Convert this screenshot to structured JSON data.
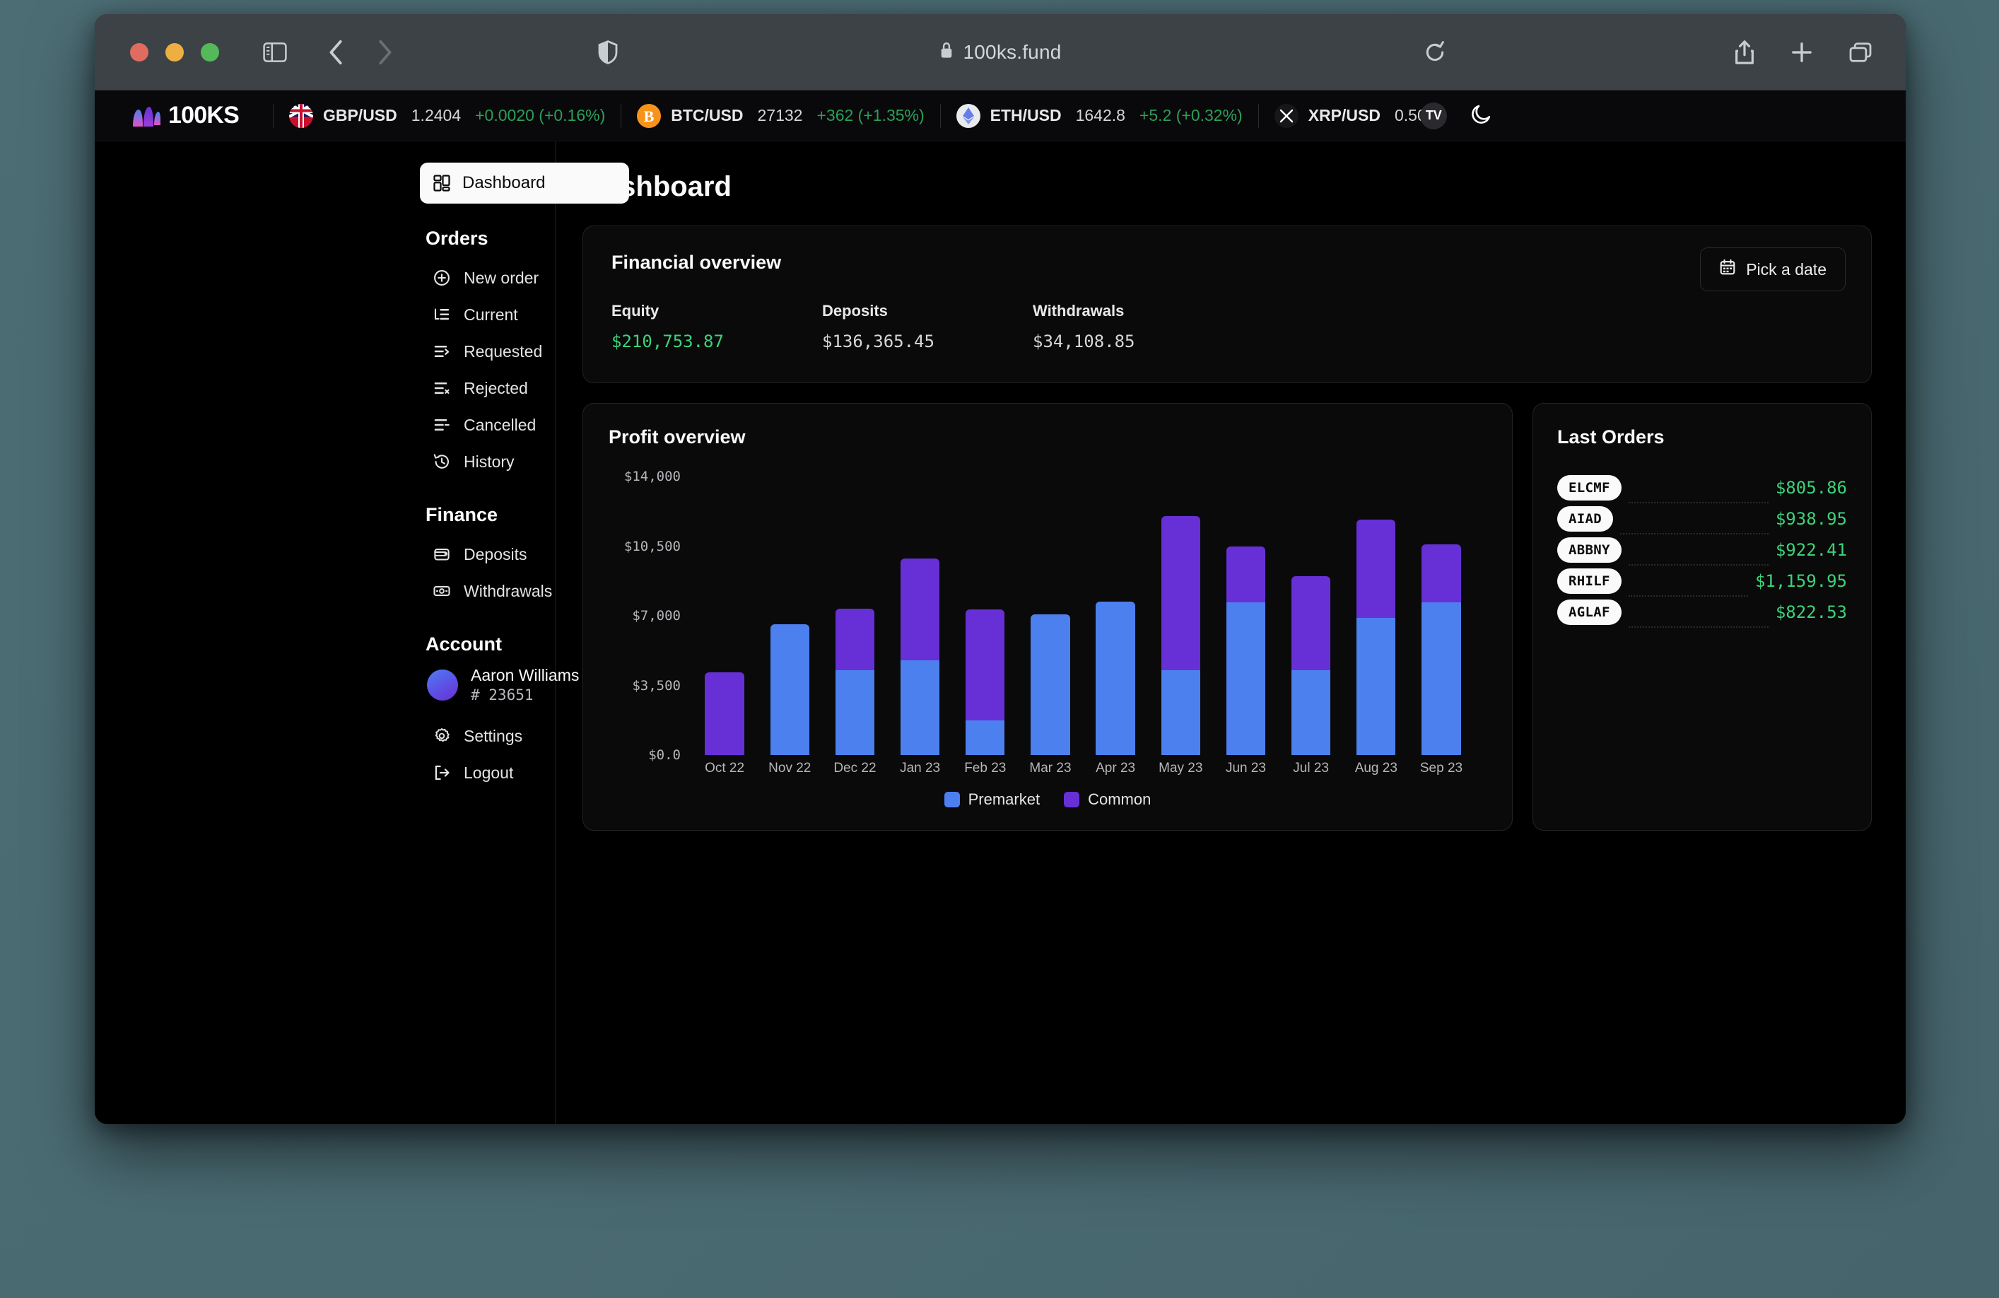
{
  "browser": {
    "url": "100ks.fund",
    "lock_icon": "lock-icon",
    "traffic_lights": [
      "close",
      "minimize",
      "maximize"
    ],
    "toolbar_icons": [
      "sidebar-toggle-icon",
      "back-icon",
      "forward-icon",
      "shield-icon",
      "reload-icon",
      "share-icon",
      "new-tab-icon",
      "tabs-overview-icon"
    ]
  },
  "ticker": {
    "brand": "100KS",
    "items": [
      {
        "icon": "gbp-flag-icon",
        "pair": "GBP/USD",
        "price": "1.2404",
        "change": "+0.0020 (+0.16%)"
      },
      {
        "icon": "bitcoin-icon",
        "pair": "BTC/USD",
        "price": "27132",
        "change": "+362 (+1.35%)"
      },
      {
        "icon": "ethereum-icon",
        "pair": "ETH/USD",
        "price": "1642.8",
        "change": "+5.2 (+0.32%)"
      },
      {
        "icon": "xrp-icon",
        "pair": "XRP/USD",
        "price": "0.5012",
        "change": ""
      }
    ],
    "badge": "TV",
    "theme_toggle": "moon-icon"
  },
  "sidebar": {
    "dashboard": {
      "label": "Dashboard",
      "icon": "grid-icon"
    },
    "sections": [
      {
        "title": "Orders",
        "items": [
          {
            "label": "New order",
            "icon": "plus-circle-icon"
          },
          {
            "label": "Current",
            "icon": "list-tree-icon"
          },
          {
            "label": "Requested",
            "icon": "list-arrow-icon"
          },
          {
            "label": "Rejected",
            "icon": "list-x-icon"
          },
          {
            "label": "Cancelled",
            "icon": "list-minus-icon"
          },
          {
            "label": "History",
            "icon": "history-icon"
          }
        ]
      },
      {
        "title": "Finance",
        "items": [
          {
            "label": "Deposits",
            "icon": "wallet-icon"
          },
          {
            "label": "Withdrawals",
            "icon": "banknote-icon"
          }
        ]
      }
    ],
    "account": {
      "title": "Account",
      "user_name": "Aaron Williams",
      "user_id": "# 23651",
      "settings": {
        "label": "Settings",
        "icon": "gear-icon"
      },
      "logout": {
        "label": "Logout",
        "icon": "logout-icon"
      }
    }
  },
  "main": {
    "page_title": "Dashboard",
    "financial": {
      "title": "Financial overview",
      "pick_date_label": "Pick a date",
      "pick_date_icon": "calendar-icon",
      "stats": [
        {
          "label": "Equity",
          "value": "$210,753.87",
          "positive": true
        },
        {
          "label": "Deposits",
          "value": "$136,365.45",
          "positive": false
        },
        {
          "label": "Withdrawals",
          "value": "$34,108.85",
          "positive": false
        }
      ]
    },
    "profit": {
      "title": "Profit overview"
    },
    "orders": {
      "title": "Last Orders",
      "rows": [
        {
          "ticker": "ELCMF",
          "amount": "$805.86"
        },
        {
          "ticker": "AIAD",
          "amount": "$938.95"
        },
        {
          "ticker": "ABBNY",
          "amount": "$922.41"
        },
        {
          "ticker": "RHILF",
          "amount": "$1,159.95"
        },
        {
          "ticker": "AGLAF",
          "amount": "$822.53"
        }
      ]
    }
  },
  "colors": {
    "premarket": "#4d80ef",
    "common": "#6730d6",
    "positive": "#3dd27a",
    "card_bg": "#0a0a0a",
    "card_border": "#232326"
  },
  "chart_data": {
    "type": "bar",
    "title": "Profit overview",
    "stacked": true,
    "xlabel": "",
    "ylabel": "",
    "ylim": [
      0,
      14000
    ],
    "yticks": [
      0,
      3500,
      7000,
      10500,
      14000
    ],
    "ytick_labels": [
      "$0.0",
      "$3,500",
      "$7,000",
      "$10,500",
      "$14,000"
    ],
    "grid": false,
    "legend_position": "bottom",
    "categories": [
      "Oct 22",
      "Nov 22",
      "Dec 22",
      "Jan 23",
      "Feb 23",
      "Mar 23",
      "Apr 23",
      "May 23",
      "Jun 23",
      "Jul 23",
      "Aug 23",
      "Sep 23"
    ],
    "series": [
      {
        "name": "Premarket",
        "color": "#4d80ef",
        "values": [
          0,
          6560,
          4260,
          4770,
          1740,
          7080,
          7700,
          4260,
          7660,
          4260,
          6880,
          7660
        ]
      },
      {
        "name": "Common",
        "color": "#6730d6",
        "values": [
          4160,
          0,
          3090,
          5100,
          5590,
          0,
          0,
          7740,
          2810,
          4720,
          4940,
          2920
        ]
      }
    ],
    "totals": [
      4160,
      6560,
      7350,
      9870,
      7330,
      7080,
      7700,
      12000,
      10470,
      8980,
      11820,
      10580
    ]
  }
}
